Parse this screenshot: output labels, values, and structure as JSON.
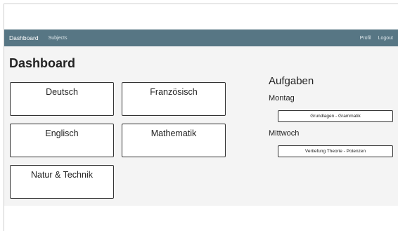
{
  "navbar": {
    "brand": "Dashboard",
    "links": [
      "Subjects"
    ],
    "right_links": [
      "Profil",
      "Logout"
    ],
    "background": "#577684"
  },
  "page_title": "Dashboard",
  "subjects": [
    "Deutsch",
    "Französisch",
    "Englisch",
    "Mathematik",
    "Natur & Technik"
  ],
  "tasks": {
    "title": "Aufgaben",
    "days": [
      {
        "day": "Montag",
        "items": [
          "Grundlagen - Grammatik"
        ]
      },
      {
        "day": "Mittwoch",
        "items": [
          "Vertiefung Theorie - Potenzen"
        ]
      }
    ]
  }
}
